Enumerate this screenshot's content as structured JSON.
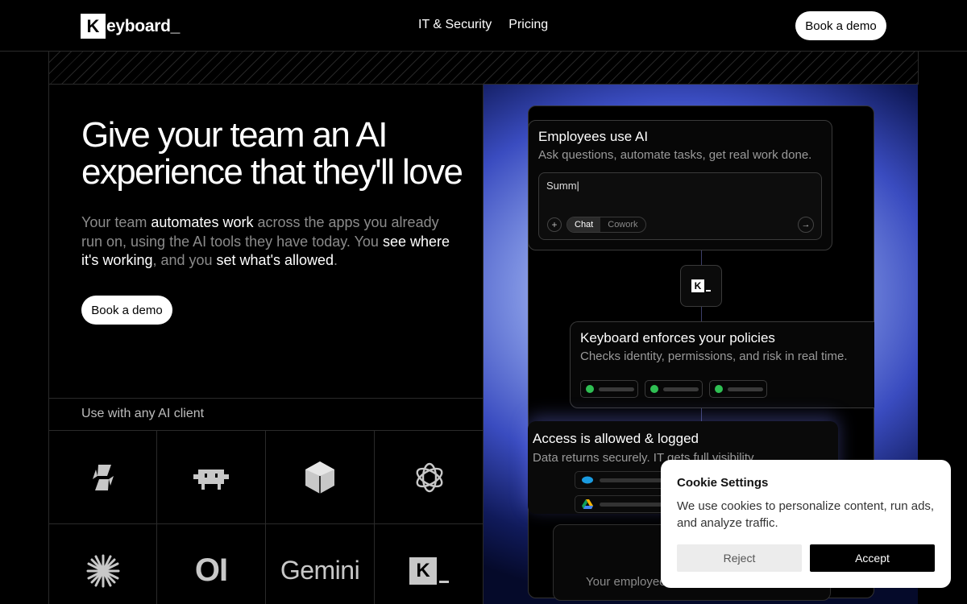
{
  "nav": {
    "logo_letter": "K",
    "logo_text": "eyboard_",
    "links": [
      "IT & Security",
      "Pricing"
    ],
    "cta": "Book a demo"
  },
  "hero": {
    "title": "Give your team an AI experience that they'll love",
    "sub_parts": [
      {
        "text": "Your team ",
        "hl": false
      },
      {
        "text": "automates work",
        "hl": true
      },
      {
        "text": " across the apps you already run on, using the AI tools they have today. You ",
        "hl": false
      },
      {
        "text": "see where it's working",
        "hl": true
      },
      {
        "text": ", and you ",
        "hl": false
      },
      {
        "text": "set what's allowed",
        "hl": true
      },
      {
        "text": ".",
        "hl": false
      }
    ],
    "cta": "Book a demo"
  },
  "clients": {
    "label": "Use with any AI client",
    "items": [
      {
        "name": "copilot-icon"
      },
      {
        "name": "robot-icon"
      },
      {
        "name": "cube-icon"
      },
      {
        "name": "openai-icon"
      },
      {
        "name": "claude-icon"
      },
      {
        "name": "openinterpreter-logo",
        "text": "OI"
      },
      {
        "name": "gemini-logo",
        "text": "Gemini"
      },
      {
        "name": "keyboard-logo",
        "text": "K"
      }
    ]
  },
  "flow": {
    "card1": {
      "title": "Employees use AI",
      "sub": "Ask questions, automate tasks, get real work done.",
      "input_value": "Summ|",
      "modes": [
        "Chat",
        "Cowork"
      ],
      "active_mode": "Chat"
    },
    "badge_letter": "K",
    "card2": {
      "title": "Keyboard enforces your policies",
      "sub": "Checks identity, permissions, and risk in real time.",
      "check_color": "#2fbf53"
    },
    "card3": {
      "title": "Access is allowed & logged",
      "sub": "Data returns securely. IT gets full visibility",
      "rows": [
        {
          "icon": "salesforce-icon"
        },
        {
          "icon": "google-drive-icon"
        }
      ]
    },
    "card4": {
      "text": "Your employee"
    }
  },
  "cookie": {
    "title": "Cookie Settings",
    "body": "We use cookies to personalize content, run ads, and analyze traffic.",
    "reject": "Reject",
    "accept": "Accept"
  }
}
